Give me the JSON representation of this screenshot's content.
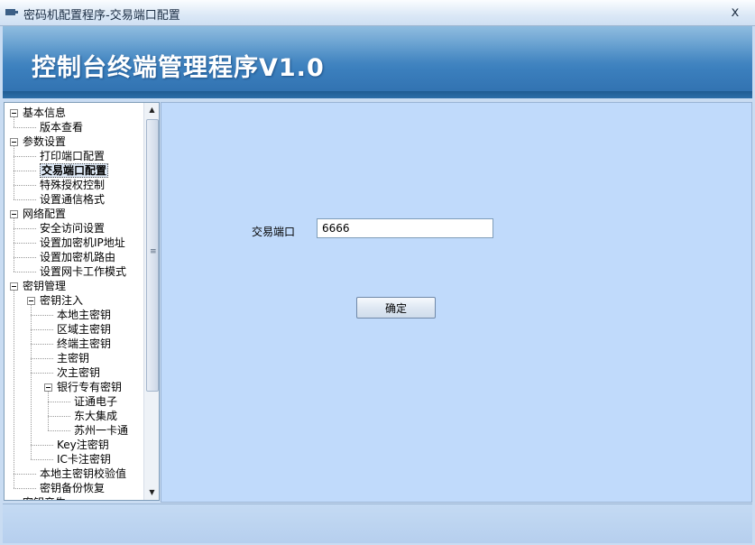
{
  "window": {
    "title": "密码机配置程序-交易端口配置",
    "close_glyph": "x"
  },
  "banner": {
    "title": "控制台终端管理程序V1.0"
  },
  "tree": {
    "items": [
      {
        "label": "基本信息",
        "level": 0,
        "expanded": true
      },
      {
        "label": "版本查看",
        "level": 1
      },
      {
        "label": "参数设置",
        "level": 0,
        "expanded": true
      },
      {
        "label": "打印端口配置",
        "level": 1
      },
      {
        "label": "交易端口配置",
        "level": 1,
        "selected": true
      },
      {
        "label": "特殊授权控制",
        "level": 1
      },
      {
        "label": "设置通信格式",
        "level": 1
      },
      {
        "label": "网络配置",
        "level": 0,
        "expanded": true
      },
      {
        "label": "安全访问设置",
        "level": 1
      },
      {
        "label": "设置加密机IP地址",
        "level": 1
      },
      {
        "label": "设置加密机路由",
        "level": 1
      },
      {
        "label": "设置网卡工作模式",
        "level": 1
      },
      {
        "label": "密钥管理",
        "level": 0,
        "expanded": true
      },
      {
        "label": "密钥注入",
        "level": 1,
        "expanded": true
      },
      {
        "label": "本地主密钥",
        "level": 2
      },
      {
        "label": "区域主密钥",
        "level": 2
      },
      {
        "label": "终端主密钥",
        "level": 2
      },
      {
        "label": "主密钥",
        "level": 2
      },
      {
        "label": "次主密钥",
        "level": 2
      },
      {
        "label": "银行专有密钥",
        "level": 2,
        "expanded": true
      },
      {
        "label": "证通电子",
        "level": 3
      },
      {
        "label": "东大集成",
        "level": 3
      },
      {
        "label": "苏州一卡通",
        "level": 3
      },
      {
        "label": "Key注密钥",
        "level": 2
      },
      {
        "label": "IC卡注密钥",
        "level": 2
      },
      {
        "label": "本地主密钥校验值",
        "level": 1
      },
      {
        "label": "密钥备份恢复",
        "level": 1
      },
      {
        "label": "密钥产生",
        "level": 0
      }
    ]
  },
  "form": {
    "port_label": "交易端口",
    "port_value": "6666",
    "ok_label": "确定"
  }
}
